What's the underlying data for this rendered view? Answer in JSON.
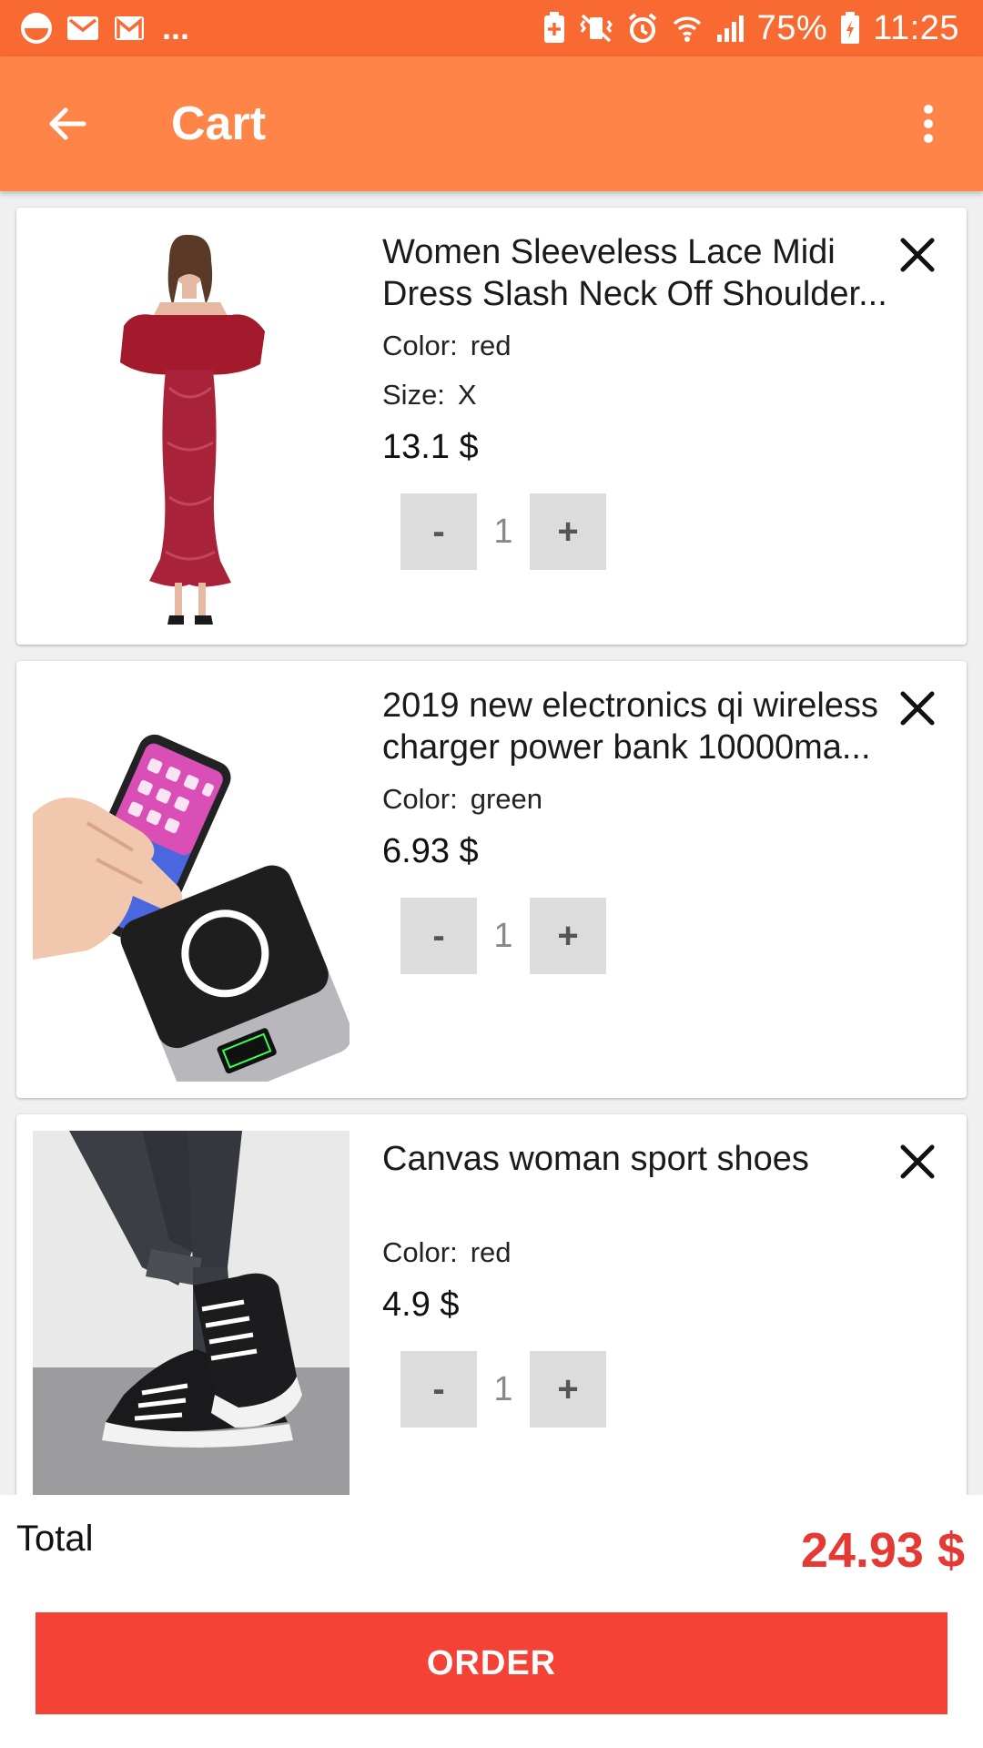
{
  "status_bar": {
    "overflow_indicator": "...",
    "battery_percent": "75%",
    "time": "11:25"
  },
  "app_bar": {
    "title": "Cart"
  },
  "cart": {
    "color_label": "Color:",
    "size_label": "Size:",
    "items": [
      {
        "name": "Women Sleeveless Lace Midi Dress Slash Neck Off Shoulder...",
        "color": "red",
        "size": "X",
        "price": "13.1 $",
        "quantity": "1"
      },
      {
        "name": "2019 new electronics qi wireless charger power bank 10000ma...",
        "color": "green",
        "price": "6.93 $",
        "quantity": "1"
      },
      {
        "name": "Canvas woman sport shoes",
        "color": "red",
        "price": "4.9 $",
        "quantity": "1"
      }
    ],
    "stepper": {
      "decrement_label": "-",
      "increment_label": "+"
    },
    "screen_label": "Canvas woman sport shoes"
  },
  "footer": {
    "total_label": "Total",
    "total_value": "24.93 $",
    "order_label": "ORDER"
  },
  "colors": {
    "status_bar": "#f96a32",
    "app_bar": "#ff8447",
    "accent_red": "#f44336",
    "total_red": "#e53935"
  }
}
